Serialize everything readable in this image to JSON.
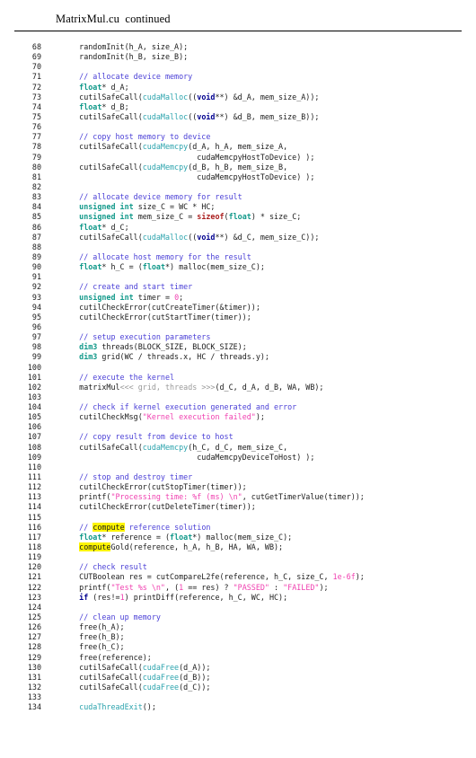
{
  "header": {
    "title": "MatrixMul.cu  continued"
  },
  "colors": {
    "comment": "#4a3fd6",
    "type": "#12998a",
    "keyword": "#00008f",
    "builtin": "#aa1e1e",
    "function": "#2ba3ad",
    "string": "#f040b0",
    "number": "#f040b0",
    "plain": "#1a1a1a",
    "gray": "#9a9a9a",
    "highlight": "#fdf400",
    "rule": "#000000"
  },
  "listing": {
    "language": "cuda",
    "first_line": 68,
    "last_line": 134,
    "lines": [
      {
        "n": "68",
        "tokens": [
          {
            "t": "plain",
            "v": "    randomInit(h_A, size_A);"
          }
        ]
      },
      {
        "n": "69",
        "tokens": [
          {
            "t": "plain",
            "v": "    randomInit(h_B, size_B);"
          }
        ]
      },
      {
        "n": "70",
        "tokens": []
      },
      {
        "n": "71",
        "tokens": [
          {
            "t": "plain",
            "v": "    "
          },
          {
            "t": "comment",
            "v": "// allocate device memory"
          }
        ]
      },
      {
        "n": "72",
        "tokens": [
          {
            "t": "plain",
            "v": "    "
          },
          {
            "t": "type",
            "v": "float"
          },
          {
            "t": "plain",
            "v": "* d_A;"
          }
        ]
      },
      {
        "n": "73",
        "tokens": [
          {
            "t": "plain",
            "v": "    cutilSafeCall("
          },
          {
            "t": "func",
            "v": "cudaMalloc"
          },
          {
            "t": "plain",
            "v": "(("
          },
          {
            "t": "keyword",
            "v": "void"
          },
          {
            "t": "plain",
            "v": "**) &d_A, mem_size_A));"
          }
        ]
      },
      {
        "n": "74",
        "tokens": [
          {
            "t": "plain",
            "v": "    "
          },
          {
            "t": "type",
            "v": "float"
          },
          {
            "t": "plain",
            "v": "* d_B;"
          }
        ]
      },
      {
        "n": "75",
        "tokens": [
          {
            "t": "plain",
            "v": "    cutilSafeCall("
          },
          {
            "t": "func",
            "v": "cudaMalloc"
          },
          {
            "t": "plain",
            "v": "(("
          },
          {
            "t": "keyword",
            "v": "void"
          },
          {
            "t": "plain",
            "v": "**) &d_B, mem_size_B));"
          }
        ]
      },
      {
        "n": "76",
        "tokens": []
      },
      {
        "n": "77",
        "tokens": [
          {
            "t": "plain",
            "v": "    "
          },
          {
            "t": "comment",
            "v": "// copy host memory to device"
          }
        ]
      },
      {
        "n": "78",
        "tokens": [
          {
            "t": "plain",
            "v": "    cutilSafeCall("
          },
          {
            "t": "func",
            "v": "cudaMemcpy"
          },
          {
            "t": "plain",
            "v": "(d_A, h_A, mem_size_A,"
          }
        ]
      },
      {
        "n": "79",
        "tokens": [
          {
            "t": "plain",
            "v": "                              cudaMemcpyHostToDevice) );"
          }
        ]
      },
      {
        "n": "80",
        "tokens": [
          {
            "t": "plain",
            "v": "    cutilSafeCall("
          },
          {
            "t": "func",
            "v": "cudaMemcpy"
          },
          {
            "t": "plain",
            "v": "(d_B, h_B, mem_size_B,"
          }
        ]
      },
      {
        "n": "81",
        "tokens": [
          {
            "t": "plain",
            "v": "                              cudaMemcpyHostToDevice) );"
          }
        ]
      },
      {
        "n": "82",
        "tokens": []
      },
      {
        "n": "83",
        "tokens": [
          {
            "t": "plain",
            "v": "    "
          },
          {
            "t": "comment",
            "v": "// allocate device memory for result"
          }
        ]
      },
      {
        "n": "84",
        "tokens": [
          {
            "t": "plain",
            "v": "    "
          },
          {
            "t": "type",
            "v": "unsigned int"
          },
          {
            "t": "plain",
            "v": " size_C = WC * HC;"
          }
        ]
      },
      {
        "n": "85",
        "tokens": [
          {
            "t": "plain",
            "v": "    "
          },
          {
            "t": "type",
            "v": "unsigned int"
          },
          {
            "t": "plain",
            "v": " mem_size_C = "
          },
          {
            "t": "builtin",
            "v": "sizeof"
          },
          {
            "t": "plain",
            "v": "("
          },
          {
            "t": "type",
            "v": "float"
          },
          {
            "t": "plain",
            "v": ") * size_C;"
          }
        ]
      },
      {
        "n": "86",
        "tokens": [
          {
            "t": "plain",
            "v": "    "
          },
          {
            "t": "type",
            "v": "float"
          },
          {
            "t": "plain",
            "v": "* d_C;"
          }
        ]
      },
      {
        "n": "87",
        "tokens": [
          {
            "t": "plain",
            "v": "    cutilSafeCall("
          },
          {
            "t": "func",
            "v": "cudaMalloc"
          },
          {
            "t": "plain",
            "v": "(("
          },
          {
            "t": "keyword",
            "v": "void"
          },
          {
            "t": "plain",
            "v": "**) &d_C, mem_size_C));"
          }
        ]
      },
      {
        "n": "88",
        "tokens": []
      },
      {
        "n": "89",
        "tokens": [
          {
            "t": "plain",
            "v": "    "
          },
          {
            "t": "comment",
            "v": "// allocate host memory for the result"
          }
        ]
      },
      {
        "n": "90",
        "tokens": [
          {
            "t": "plain",
            "v": "    "
          },
          {
            "t": "type",
            "v": "float"
          },
          {
            "t": "plain",
            "v": "* h_C = ("
          },
          {
            "t": "type",
            "v": "float"
          },
          {
            "t": "plain",
            "v": "*) malloc(mem_size_C);"
          }
        ]
      },
      {
        "n": "91",
        "tokens": []
      },
      {
        "n": "92",
        "tokens": [
          {
            "t": "plain",
            "v": "    "
          },
          {
            "t": "comment",
            "v": "// create and start timer"
          }
        ]
      },
      {
        "n": "93",
        "tokens": [
          {
            "t": "plain",
            "v": "    "
          },
          {
            "t": "type",
            "v": "unsigned int"
          },
          {
            "t": "plain",
            "v": " timer = "
          },
          {
            "t": "number",
            "v": "0"
          },
          {
            "t": "plain",
            "v": ";"
          }
        ]
      },
      {
        "n": "94",
        "tokens": [
          {
            "t": "plain",
            "v": "    cutilCheckError(cutCreateTimer(&timer));"
          }
        ]
      },
      {
        "n": "95",
        "tokens": [
          {
            "t": "plain",
            "v": "    cutilCheckError(cutStartTimer(timer));"
          }
        ]
      },
      {
        "n": "96",
        "tokens": []
      },
      {
        "n": "97",
        "tokens": [
          {
            "t": "plain",
            "v": "    "
          },
          {
            "t": "comment",
            "v": "// setup execution parameters"
          }
        ]
      },
      {
        "n": "98",
        "tokens": [
          {
            "t": "plain",
            "v": "    "
          },
          {
            "t": "type",
            "v": "dim3"
          },
          {
            "t": "plain",
            "v": " threads(BLOCK_SIZE, BLOCK_SIZE);"
          }
        ]
      },
      {
        "n": "99",
        "tokens": [
          {
            "t": "plain",
            "v": "    "
          },
          {
            "t": "type",
            "v": "dim3"
          },
          {
            "t": "plain",
            "v": " grid(WC / threads.x, HC / threads.y);"
          }
        ]
      },
      {
        "n": "100",
        "tokens": []
      },
      {
        "n": "101",
        "tokens": [
          {
            "t": "plain",
            "v": "    "
          },
          {
            "t": "comment",
            "v": "// execute the kernel"
          }
        ]
      },
      {
        "n": "102",
        "tokens": [
          {
            "t": "plain",
            "v": "    matrixMul"
          },
          {
            "t": "gray",
            "v": "<<< grid, threads >>>"
          },
          {
            "t": "plain",
            "v": "(d_C, d_A, d_B, WA, WB);"
          }
        ]
      },
      {
        "n": "103",
        "tokens": []
      },
      {
        "n": "104",
        "tokens": [
          {
            "t": "plain",
            "v": "    "
          },
          {
            "t": "comment",
            "v": "// check if kernel execution generated and error"
          }
        ]
      },
      {
        "n": "105",
        "tokens": [
          {
            "t": "plain",
            "v": "    cutilCheckMsg("
          },
          {
            "t": "string",
            "v": "\"Kernel execution failed\""
          },
          {
            "t": "plain",
            "v": ");"
          }
        ]
      },
      {
        "n": "106",
        "tokens": []
      },
      {
        "n": "107",
        "tokens": [
          {
            "t": "plain",
            "v": "    "
          },
          {
            "t": "comment",
            "v": "// copy result from device to host"
          }
        ]
      },
      {
        "n": "108",
        "tokens": [
          {
            "t": "plain",
            "v": "    cutilSafeCall("
          },
          {
            "t": "func",
            "v": "cudaMemcpy"
          },
          {
            "t": "plain",
            "v": "(h_C, d_C, mem_size_C,"
          }
        ]
      },
      {
        "n": "109",
        "tokens": [
          {
            "t": "plain",
            "v": "                              cudaMemcpyDeviceToHost) );"
          }
        ]
      },
      {
        "n": "110",
        "tokens": []
      },
      {
        "n": "111",
        "tokens": [
          {
            "t": "plain",
            "v": "    "
          },
          {
            "t": "comment",
            "v": "// stop and destroy timer"
          }
        ]
      },
      {
        "n": "112",
        "tokens": [
          {
            "t": "plain",
            "v": "    cutilCheckError(cutStopTimer(timer));"
          }
        ]
      },
      {
        "n": "113",
        "tokens": [
          {
            "t": "plain",
            "v": "    printf("
          },
          {
            "t": "string",
            "v": "\"Processing time: %f (ms) \\n\""
          },
          {
            "t": "plain",
            "v": ", cutGetTimerValue(timer));"
          }
        ]
      },
      {
        "n": "114",
        "tokens": [
          {
            "t": "plain",
            "v": "    cutilCheckError(cutDeleteTimer(timer));"
          }
        ]
      },
      {
        "n": "115",
        "tokens": []
      },
      {
        "n": "116",
        "tokens": [
          {
            "t": "plain",
            "v": "    "
          },
          {
            "t": "comment",
            "v": "// "
          },
          {
            "t": "comment-hl",
            "v": "compute"
          },
          {
            "t": "comment",
            "v": " reference solution"
          }
        ]
      },
      {
        "n": "117",
        "tokens": [
          {
            "t": "plain",
            "v": "    "
          },
          {
            "t": "type",
            "v": "float"
          },
          {
            "t": "plain",
            "v": "* reference = ("
          },
          {
            "t": "type",
            "v": "float"
          },
          {
            "t": "plain",
            "v": "*) malloc(mem_size_C);"
          }
        ]
      },
      {
        "n": "118",
        "tokens": [
          {
            "t": "plain",
            "v": "    "
          },
          {
            "t": "plain-hl",
            "v": "compute"
          },
          {
            "t": "plain",
            "v": "Gold(reference, h_A, h_B, HA, WA, WB);"
          }
        ]
      },
      {
        "n": "119",
        "tokens": []
      },
      {
        "n": "120",
        "tokens": [
          {
            "t": "plain",
            "v": "    "
          },
          {
            "t": "comment",
            "v": "// check result"
          }
        ]
      },
      {
        "n": "121",
        "tokens": [
          {
            "t": "plain",
            "v": "    CUTBoolean res = cutCompareL2fe(reference, h_C, size_C, "
          },
          {
            "t": "number",
            "v": "1e-6f"
          },
          {
            "t": "plain",
            "v": ");"
          }
        ]
      },
      {
        "n": "122",
        "tokens": [
          {
            "t": "plain",
            "v": "    printf("
          },
          {
            "t": "string",
            "v": "\"Test %s \\n\""
          },
          {
            "t": "plain",
            "v": ", ("
          },
          {
            "t": "number",
            "v": "1"
          },
          {
            "t": "plain",
            "v": " == res) ? "
          },
          {
            "t": "string",
            "v": "\"PASSED\""
          },
          {
            "t": "plain",
            "v": " : "
          },
          {
            "t": "string",
            "v": "\"FAILED\""
          },
          {
            "t": "plain",
            "v": ");"
          }
        ]
      },
      {
        "n": "123",
        "tokens": [
          {
            "t": "plain",
            "v": "    "
          },
          {
            "t": "keyword",
            "v": "if"
          },
          {
            "t": "plain",
            "v": " (res!="
          },
          {
            "t": "number",
            "v": "1"
          },
          {
            "t": "plain",
            "v": ") printDiff(reference, h_C, WC, HC);"
          }
        ]
      },
      {
        "n": "124",
        "tokens": []
      },
      {
        "n": "125",
        "tokens": [
          {
            "t": "plain",
            "v": "    "
          },
          {
            "t": "comment",
            "v": "// clean up memory"
          }
        ]
      },
      {
        "n": "126",
        "tokens": [
          {
            "t": "plain",
            "v": "    free(h_A);"
          }
        ]
      },
      {
        "n": "127",
        "tokens": [
          {
            "t": "plain",
            "v": "    free(h_B);"
          }
        ]
      },
      {
        "n": "128",
        "tokens": [
          {
            "t": "plain",
            "v": "    free(h_C);"
          }
        ]
      },
      {
        "n": "129",
        "tokens": [
          {
            "t": "plain",
            "v": "    free(reference);"
          }
        ]
      },
      {
        "n": "130",
        "tokens": [
          {
            "t": "plain",
            "v": "    cutilSafeCall("
          },
          {
            "t": "func",
            "v": "cudaFree"
          },
          {
            "t": "plain",
            "v": "(d_A));"
          }
        ]
      },
      {
        "n": "131",
        "tokens": [
          {
            "t": "plain",
            "v": "    cutilSafeCall("
          },
          {
            "t": "func",
            "v": "cudaFree"
          },
          {
            "t": "plain",
            "v": "(d_B));"
          }
        ]
      },
      {
        "n": "132",
        "tokens": [
          {
            "t": "plain",
            "v": "    cutilSafeCall("
          },
          {
            "t": "func",
            "v": "cudaFree"
          },
          {
            "t": "plain",
            "v": "(d_C));"
          }
        ]
      },
      {
        "n": "133",
        "tokens": []
      },
      {
        "n": "134",
        "tokens": [
          {
            "t": "plain",
            "v": "    "
          },
          {
            "t": "func",
            "v": "cudaThreadExit"
          },
          {
            "t": "plain",
            "v": "();"
          }
        ]
      }
    ]
  }
}
